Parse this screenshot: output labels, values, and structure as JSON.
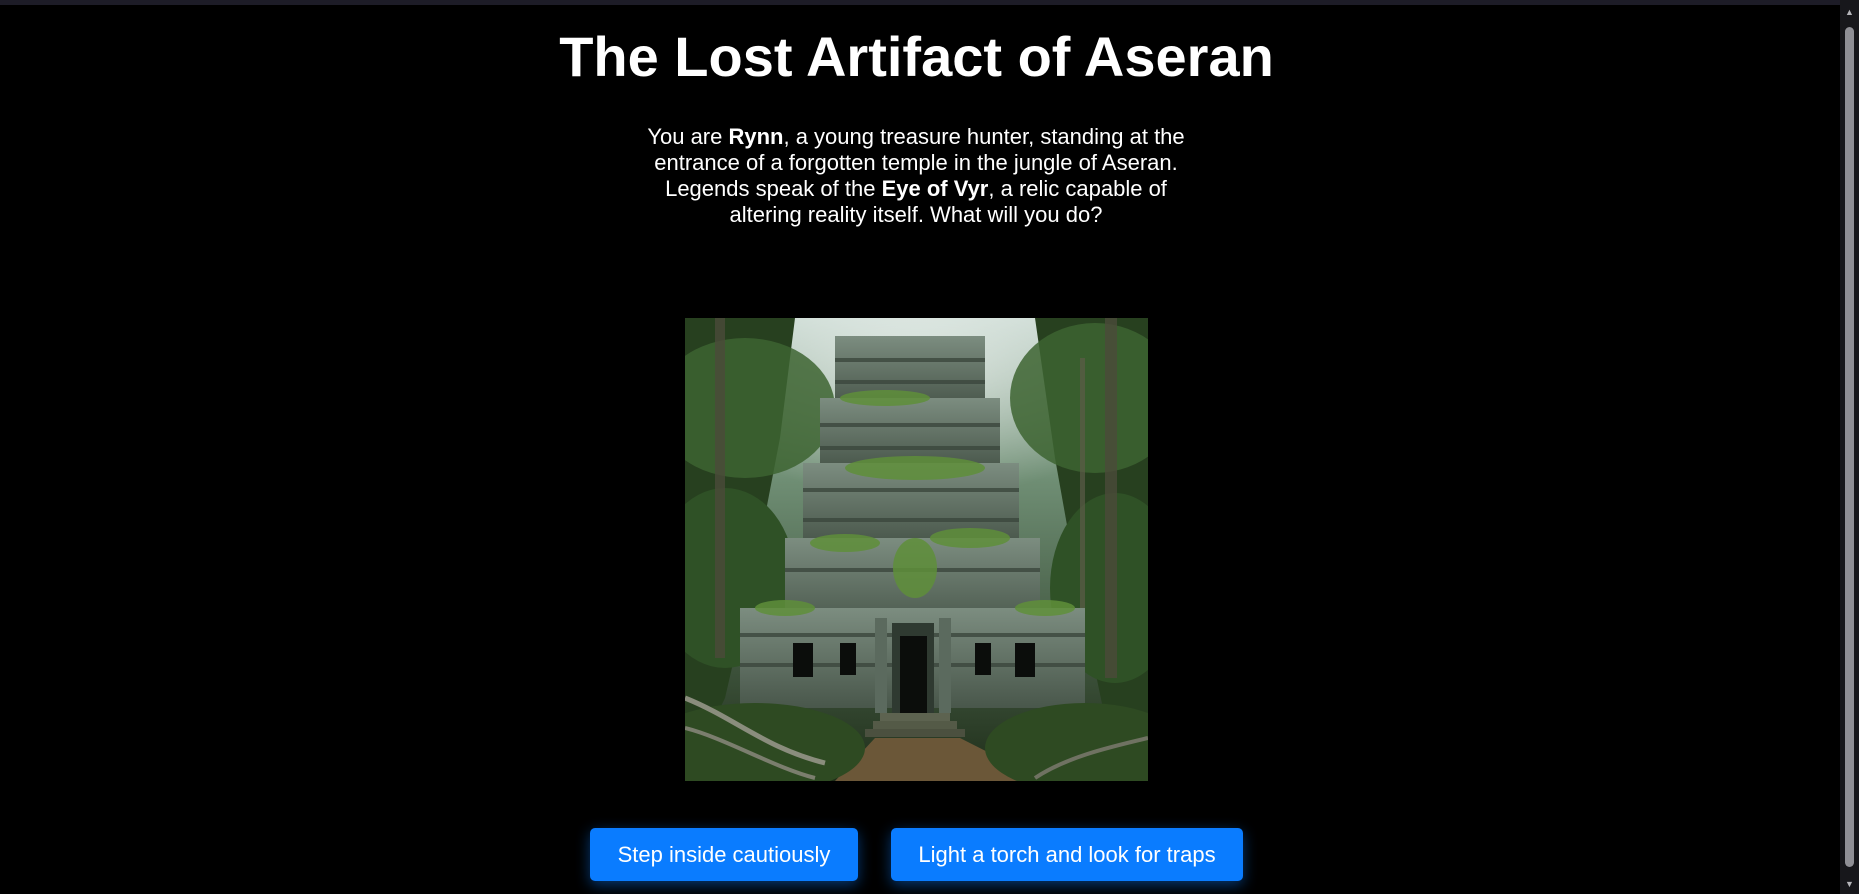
{
  "story": {
    "title": "The Lost Artifact of Aseran",
    "intro": {
      "part1": "You are ",
      "hero": "Rynn",
      "part2": ", a young treasure hunter, standing at the entrance of a forgotten temple in the jungle of Aseran. Legends speak of the ",
      "artifact": "Eye of Vyr",
      "part3": ", a relic capable of altering reality itself. What will you do?"
    },
    "scene_image": {
      "subject": "overgrown stone temple in a misty jungle",
      "icon": "temple-scene-image"
    }
  },
  "choices": [
    {
      "label": "Step inside cautiously"
    },
    {
      "label": "Light a torch and look for traps"
    }
  ],
  "scrollbar": {
    "up_icon": "▲",
    "down_icon": "▼"
  },
  "colors": {
    "background": "#000000",
    "text": "#ffffff",
    "button": "#0a7cff",
    "scrollbar_track": "#17171b",
    "scrollbar_thumb": "#8f8f95"
  }
}
